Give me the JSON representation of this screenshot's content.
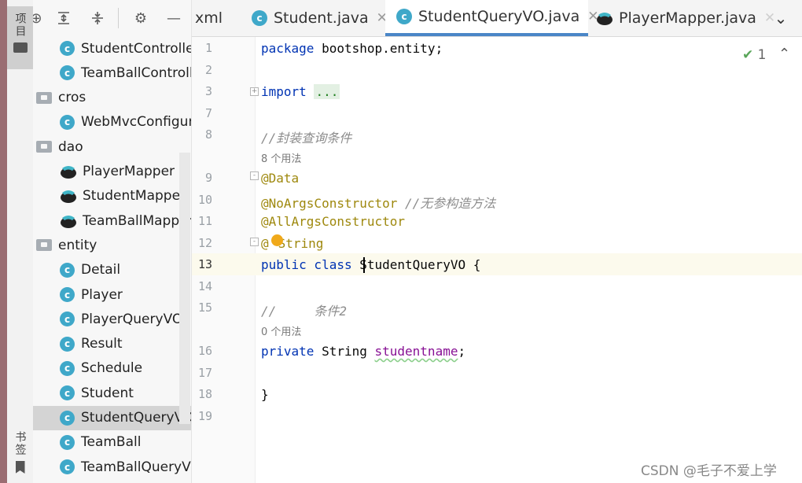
{
  "side_tabs": {
    "project": "项目",
    "bookmarks": "书签"
  },
  "project_tree": [
    {
      "label": "StudentController",
      "icon": "class-icon",
      "indent": 2
    },
    {
      "label": "TeamBallController",
      "icon": "class-icon",
      "indent": 2
    },
    {
      "label": "cros",
      "icon": "folder-icon",
      "indent": 1
    },
    {
      "label": "WebMvcConfigurer",
      "icon": "class-icon",
      "indent": 2
    },
    {
      "label": "dao",
      "icon": "folder-icon",
      "indent": 1
    },
    {
      "label": "PlayerMapper",
      "icon": "mybatis-icon",
      "indent": 2
    },
    {
      "label": "StudentMapper",
      "icon": "mybatis-icon",
      "indent": 2
    },
    {
      "label": "TeamBallMapper",
      "icon": "mybatis-icon",
      "indent": 2
    },
    {
      "label": "entity",
      "icon": "folder-icon",
      "indent": 1
    },
    {
      "label": "Detail",
      "icon": "class-icon",
      "indent": 2
    },
    {
      "label": "Player",
      "icon": "class-icon",
      "indent": 2
    },
    {
      "label": "PlayerQueryVO",
      "icon": "class-icon",
      "indent": 2
    },
    {
      "label": "Result",
      "icon": "class-icon",
      "indent": 2
    },
    {
      "label": "Schedule",
      "icon": "class-icon",
      "indent": 2
    },
    {
      "label": "Student",
      "icon": "class-icon",
      "indent": 2
    },
    {
      "label": "StudentQueryVO",
      "icon": "class-icon",
      "indent": 2,
      "selected": true
    },
    {
      "label": "TeamBall",
      "icon": "class-icon",
      "indent": 2
    },
    {
      "label": "TeamBallQueryVO",
      "icon": "class-icon",
      "indent": 2
    }
  ],
  "tabs": {
    "xml": "xml",
    "student": "Student.java",
    "studentqueryvo": "StudentQueryVO.java",
    "playermapper": "PlayerMapper.java"
  },
  "editor": {
    "line_numbers": [
      "1",
      "2",
      "3",
      "7",
      "8",
      "9",
      "10",
      "11",
      "12",
      "13",
      "14",
      "15",
      "16",
      "17",
      "18",
      "19"
    ],
    "code": {
      "l1_kw": "package",
      "l1_rest": " bootshop.entity;",
      "l3_kw": "import",
      "l3_dots": "...",
      "l8_comment": "//封装查询条件",
      "hint1": "8 个用法",
      "l9": "@Data",
      "l10_ann": "@NoArgsConstructor",
      "l10_comment": " //无参构造方法",
      "l11": "@AllArgsConstructor",
      "l12_at": "@",
      "l12_rest": "String",
      "l13_kw": "public class",
      "l13_name": " StudentQueryVO",
      "l13_brace": " {",
      "l15_comment": "//     条件2",
      "hint2": "0 个用法",
      "l16_kw": "private",
      "l16_type": " String ",
      "l16_field": "studentname",
      "l16_end": ";",
      "l18": "}"
    },
    "inspection_count": "1",
    "current_line": 13
  },
  "watermark": "CSDN @毛子不爱上学",
  "colors": {
    "accent": "#4a86c7",
    "class_icon": "#3fa8c9",
    "keyword": "#0033b3",
    "annotation": "#9e880d",
    "field": "#871094"
  }
}
